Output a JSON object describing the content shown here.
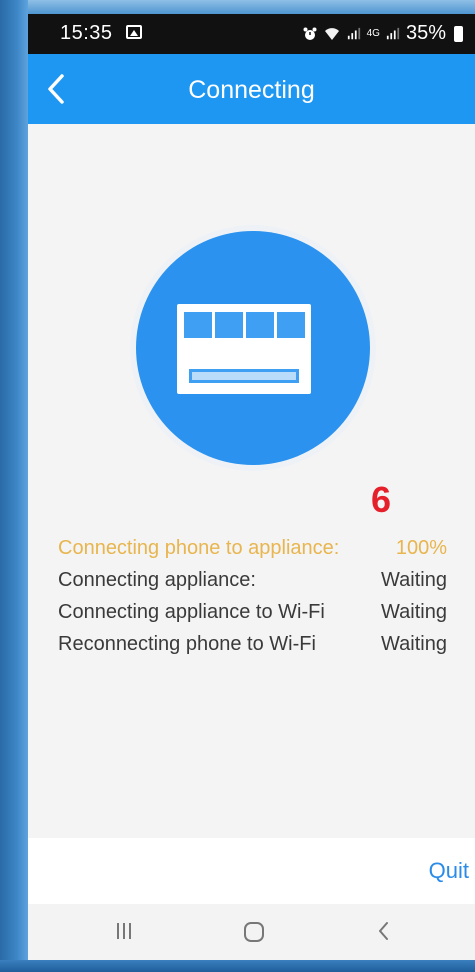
{
  "status_bar": {
    "time": "15:35",
    "network_small_top": "4G",
    "battery_percent": "35%"
  },
  "app_bar": {
    "title": "Connecting"
  },
  "annotation": {
    "number": "6"
  },
  "progress_rows": [
    {
      "label": "Connecting phone to appliance:",
      "value": "100%"
    },
    {
      "label": "Connecting appliance:",
      "value": "Waiting"
    },
    {
      "label": "Connecting appliance to Wi-Fi",
      "value": "Waiting"
    },
    {
      "label": "Reconnecting phone to Wi-Fi",
      "value": "Waiting"
    }
  ],
  "footer": {
    "quit_label": "Quit"
  },
  "colors": {
    "accent": "#1e97f3",
    "active_step": "#e8b54e",
    "annotation": "#e5202a"
  },
  "icons": [
    "image-icon",
    "alarm-icon",
    "wifi-icon",
    "signal-icon",
    "battery-icon",
    "back-arrow-icon",
    "air-conditioner-icon",
    "recent-apps-icon",
    "home-icon",
    "nav-back-icon"
  ]
}
